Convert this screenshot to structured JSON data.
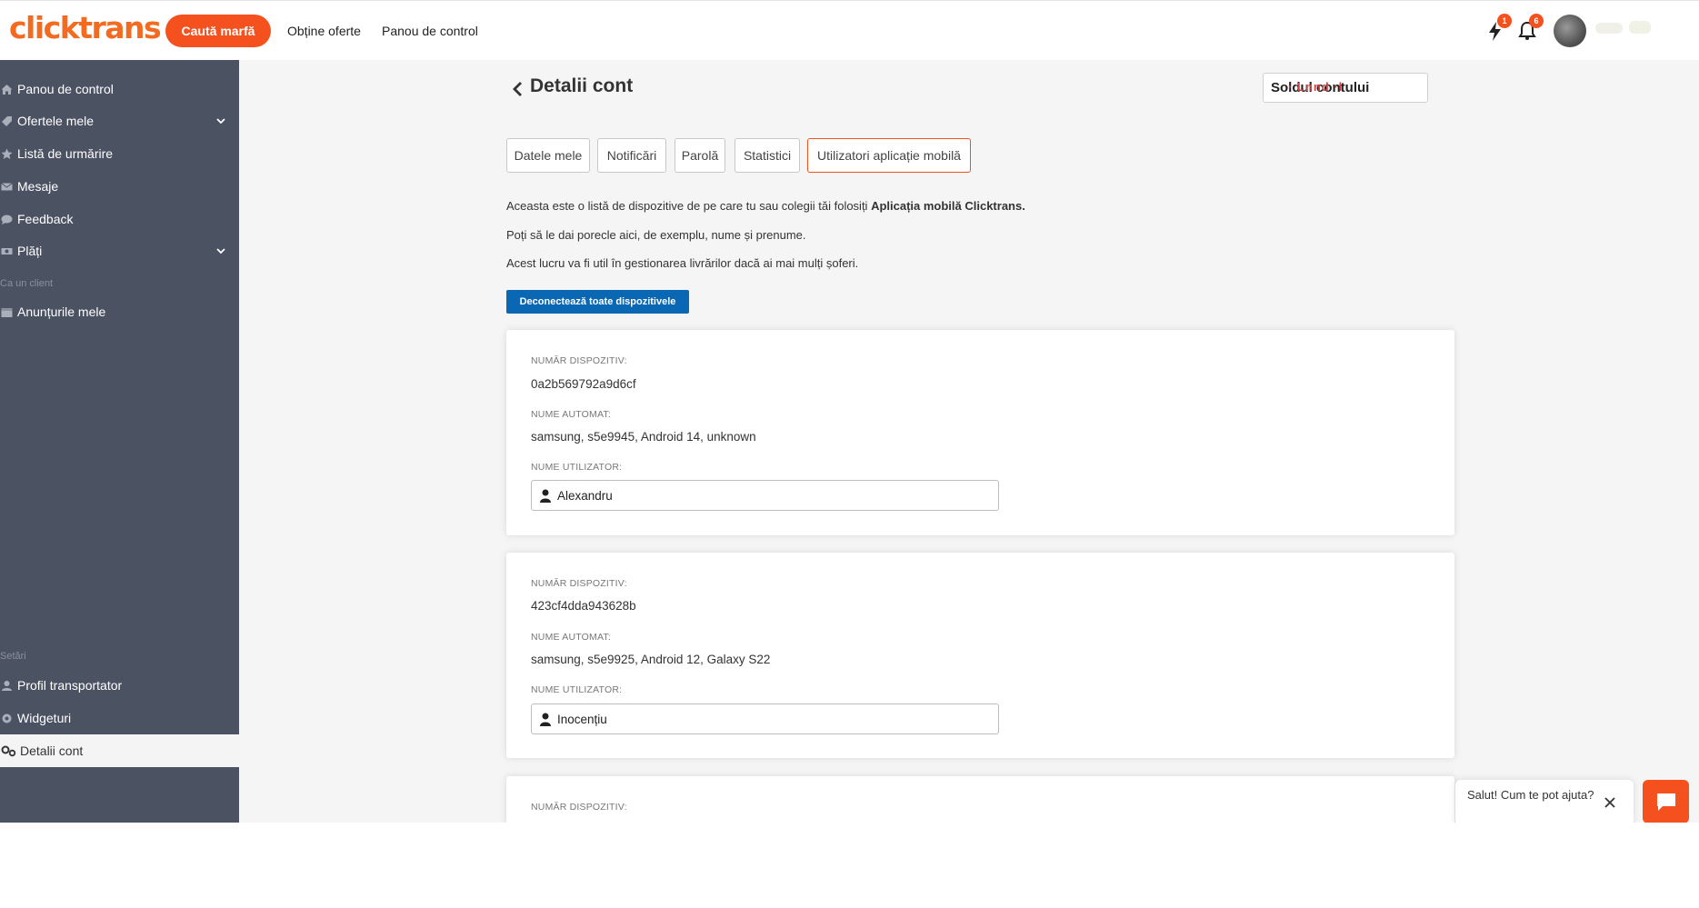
{
  "header": {
    "logo": "clicktrans",
    "search_button": "Caută marfă",
    "nav": [
      "Obține oferte",
      "Panou de control"
    ],
    "lightning_badge": "1",
    "bell_badge": "6"
  },
  "sidebar": {
    "items": [
      {
        "label": "Panou de control",
        "icon": "home-icon"
      },
      {
        "label": "Ofertele mele",
        "icon": "tag-icon",
        "expandable": true
      },
      {
        "label": "Listă de urmărire",
        "icon": "star-icon"
      },
      {
        "label": "Mesaje",
        "icon": "envelope-icon"
      },
      {
        "label": "Feedback",
        "icon": "comment-icon"
      },
      {
        "label": "Plăți",
        "icon": "money-icon",
        "expandable": true
      }
    ],
    "client_section": "Ca un client",
    "client_items": [
      {
        "label": "Anunțurile mele",
        "icon": "calendar-icon"
      }
    ],
    "settings_section": "Setări",
    "settings_items": [
      {
        "label": "Profil transportator",
        "icon": "user-icon"
      },
      {
        "label": "Widgeturi",
        "icon": "widget-icon"
      },
      {
        "label": "Detalii cont",
        "icon": "gears-icon",
        "active": true
      }
    ]
  },
  "main": {
    "title": "Detalii cont",
    "balance_label": "Soldul contului",
    "balance_value": "· Lnnd ·l",
    "tabs": [
      "Datele mele",
      "Notificări",
      "Parolă",
      "Statistici",
      "Utilizatori aplicație mobilă"
    ],
    "active_tab": 4,
    "info_line1_prefix": "Aceasta este o listă de dispozitive de pe care tu sau colegii tăi folosiți ",
    "info_line1_bold": "Aplicația mobilă Clicktrans.",
    "info_line2": "Poți să le dai porecle aici, de exemplu, nume și prenume.",
    "info_line3": "Acest lucru va fi util în gestionarea livrărilor dacă ai mai mulți șoferi.",
    "disconnect_button": "Deconectează toate dispozitivele",
    "label_device": "NUMĂR DISPOZITIV:",
    "label_auto_name": "NUME AUTOMAT:",
    "label_user_name": "NUME UTILIZATOR:",
    "devices": [
      {
        "id": "0a2b569792a9d6cf",
        "auto_name": "samsung, s5e9945, Android 14, unknown",
        "user_name": "Alexandru"
      },
      {
        "id": "423cf4dda943628b",
        "auto_name": "samsung, s5e9925, Android 12, Galaxy S22",
        "user_name": "Inocențiu"
      }
    ]
  },
  "chat": {
    "message": "Salut! Cum te pot ajuta?"
  },
  "colors": {
    "accent": "#f4511e",
    "sidebar_bg": "#4b5262",
    "primary_button": "#0a67b3"
  }
}
